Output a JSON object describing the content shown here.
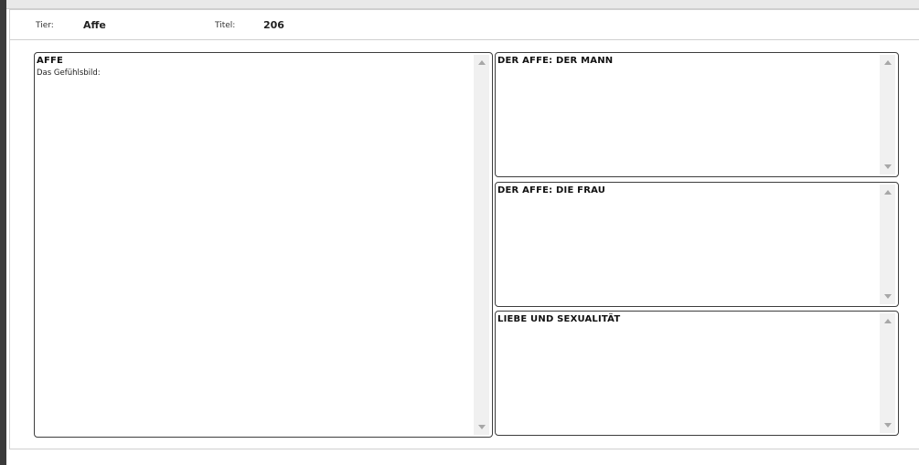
{
  "header": {
    "tier_label": "Tier:",
    "tier_value": "Affe",
    "titel_label": "Titel:",
    "titel_value": "206"
  },
  "boxes": {
    "main": {
      "title": "AFFE",
      "subtitle": "Das Gefühlsbild:"
    },
    "mann": {
      "title": "DER AFFE: DER MANN"
    },
    "frau": {
      "title": "DER AFFE: DIE FRAU"
    },
    "liebe": {
      "title": "LIEBE UND SEXUALITÄT"
    }
  },
  "icons": {
    "scroll_up": "scroll-up-icon",
    "scroll_down": "scroll-down-icon"
  }
}
